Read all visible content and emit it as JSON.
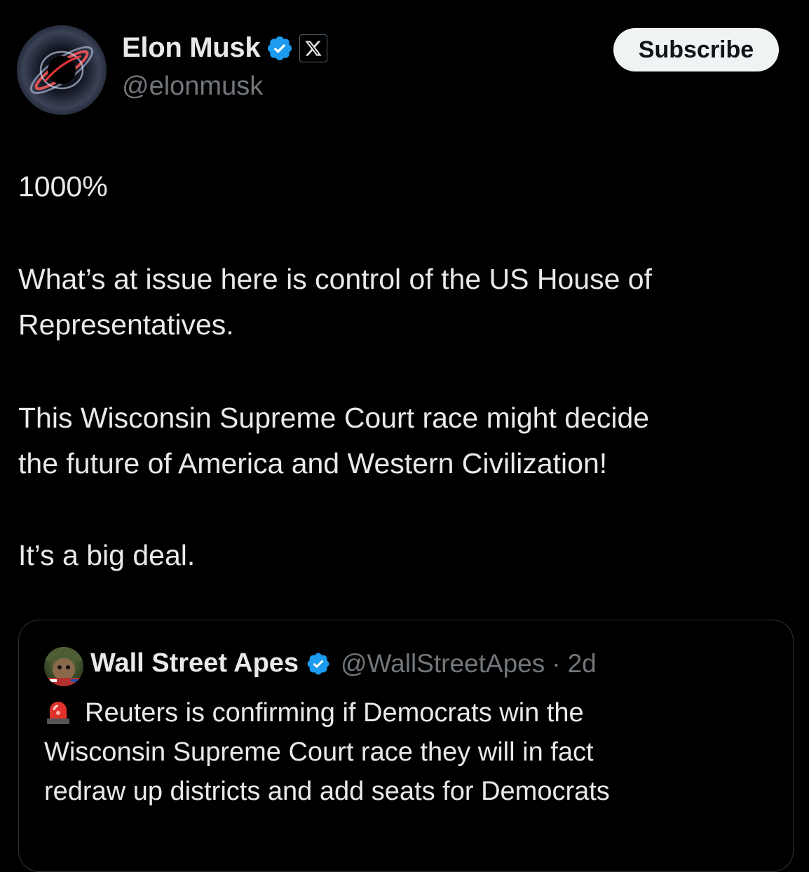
{
  "author": {
    "name": "Elon Musk",
    "handle": "@elonmusk",
    "verified_icon": "verified-badge-icon",
    "affiliation_icon": "x-logo-icon"
  },
  "subscribe_label": "Subscribe",
  "post": {
    "paragraphs": [
      "1000%",
      "What’s at issue here is control of the US House of Representatives.",
      "This Wisconsin Supreme Court race might decide the future of America and Western Civilization!",
      "It’s a big deal."
    ],
    "line_2a": "What’s at issue here is control of the US House of",
    "line_2b": "Representatives.",
    "line_3a": "This Wisconsin Supreme Court race might decide",
    "line_3b": "the future of America and Western Civilization!",
    "line_4": "It’s a big deal."
  },
  "quote": {
    "name": "Wall Street Apes",
    "handle": "@WallStreetApes",
    "separator": "·",
    "time": "2d",
    "emoji_icon": "siren-icon",
    "line_1": "Reuters is confirming if Democrats win the",
    "line_2": "Wisconsin Supreme Court race they will in fact",
    "line_3": "redraw up districts and add seats for Democrats"
  },
  "colors": {
    "background": "#000000",
    "text": "#e7e9ea",
    "muted": "#71767b",
    "verified": "#1d9bf0",
    "border": "#2f3336"
  }
}
